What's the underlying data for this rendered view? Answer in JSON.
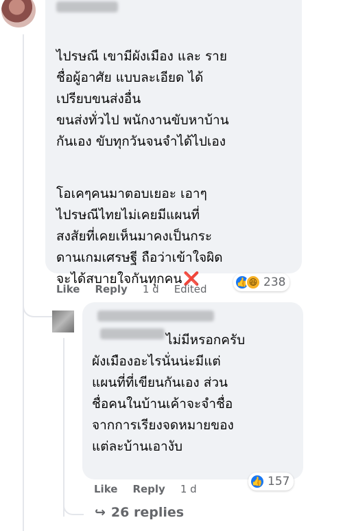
{
  "main_comment": {
    "paragraphs": [
      "ไปรษณี เขามีผังเมือง และ ราย\nชื่อผู้อาศัย แบบละเอียด ได้\nเปรียบขนส่งอื่น\nขนส่งทั่วไป พนักงานขับหาบ้าน\nกันเอง ขับทุกวันจนจำได้ไปเอง",
      "โอเคๆคนมาตอบเยอะ เอาๆ\nไปรษณีไทยไม่เคยมีแผนที่\nสงสัยที่เคยเห็นมาคงเป็นกระ\nดานเกมเศรษฐี ถือว่าเข้าใจผิด\nจะได้สบายใจกันทุกคน"
    ],
    "end_emoji": "❌",
    "actions": {
      "like": "Like",
      "reply": "Reply",
      "time": "1 d",
      "edited": "Edited"
    },
    "reaction_count": "238",
    "reactions": [
      "like-icon",
      "haha-icon"
    ]
  },
  "reply_comment": {
    "lines": [
      "ไม่มีหรอกครับ",
      "ผังเมืองอะไรนั่นน่ะมีแต่",
      "แผนที่ที่เขียนกันเอง ส่วน",
      "ชื่อคนในบ้านเค้าจะจำชื่อ",
      "จากการเรียงจดหมายของ",
      "แต่ละบ้านเอางับ"
    ],
    "actions": {
      "like": "Like",
      "reply": "Reply",
      "time": "1 d"
    },
    "reaction_count": "157",
    "reactions": [
      "like-icon"
    ]
  },
  "replies_link": {
    "arrow": "↪",
    "label": "26 replies"
  }
}
